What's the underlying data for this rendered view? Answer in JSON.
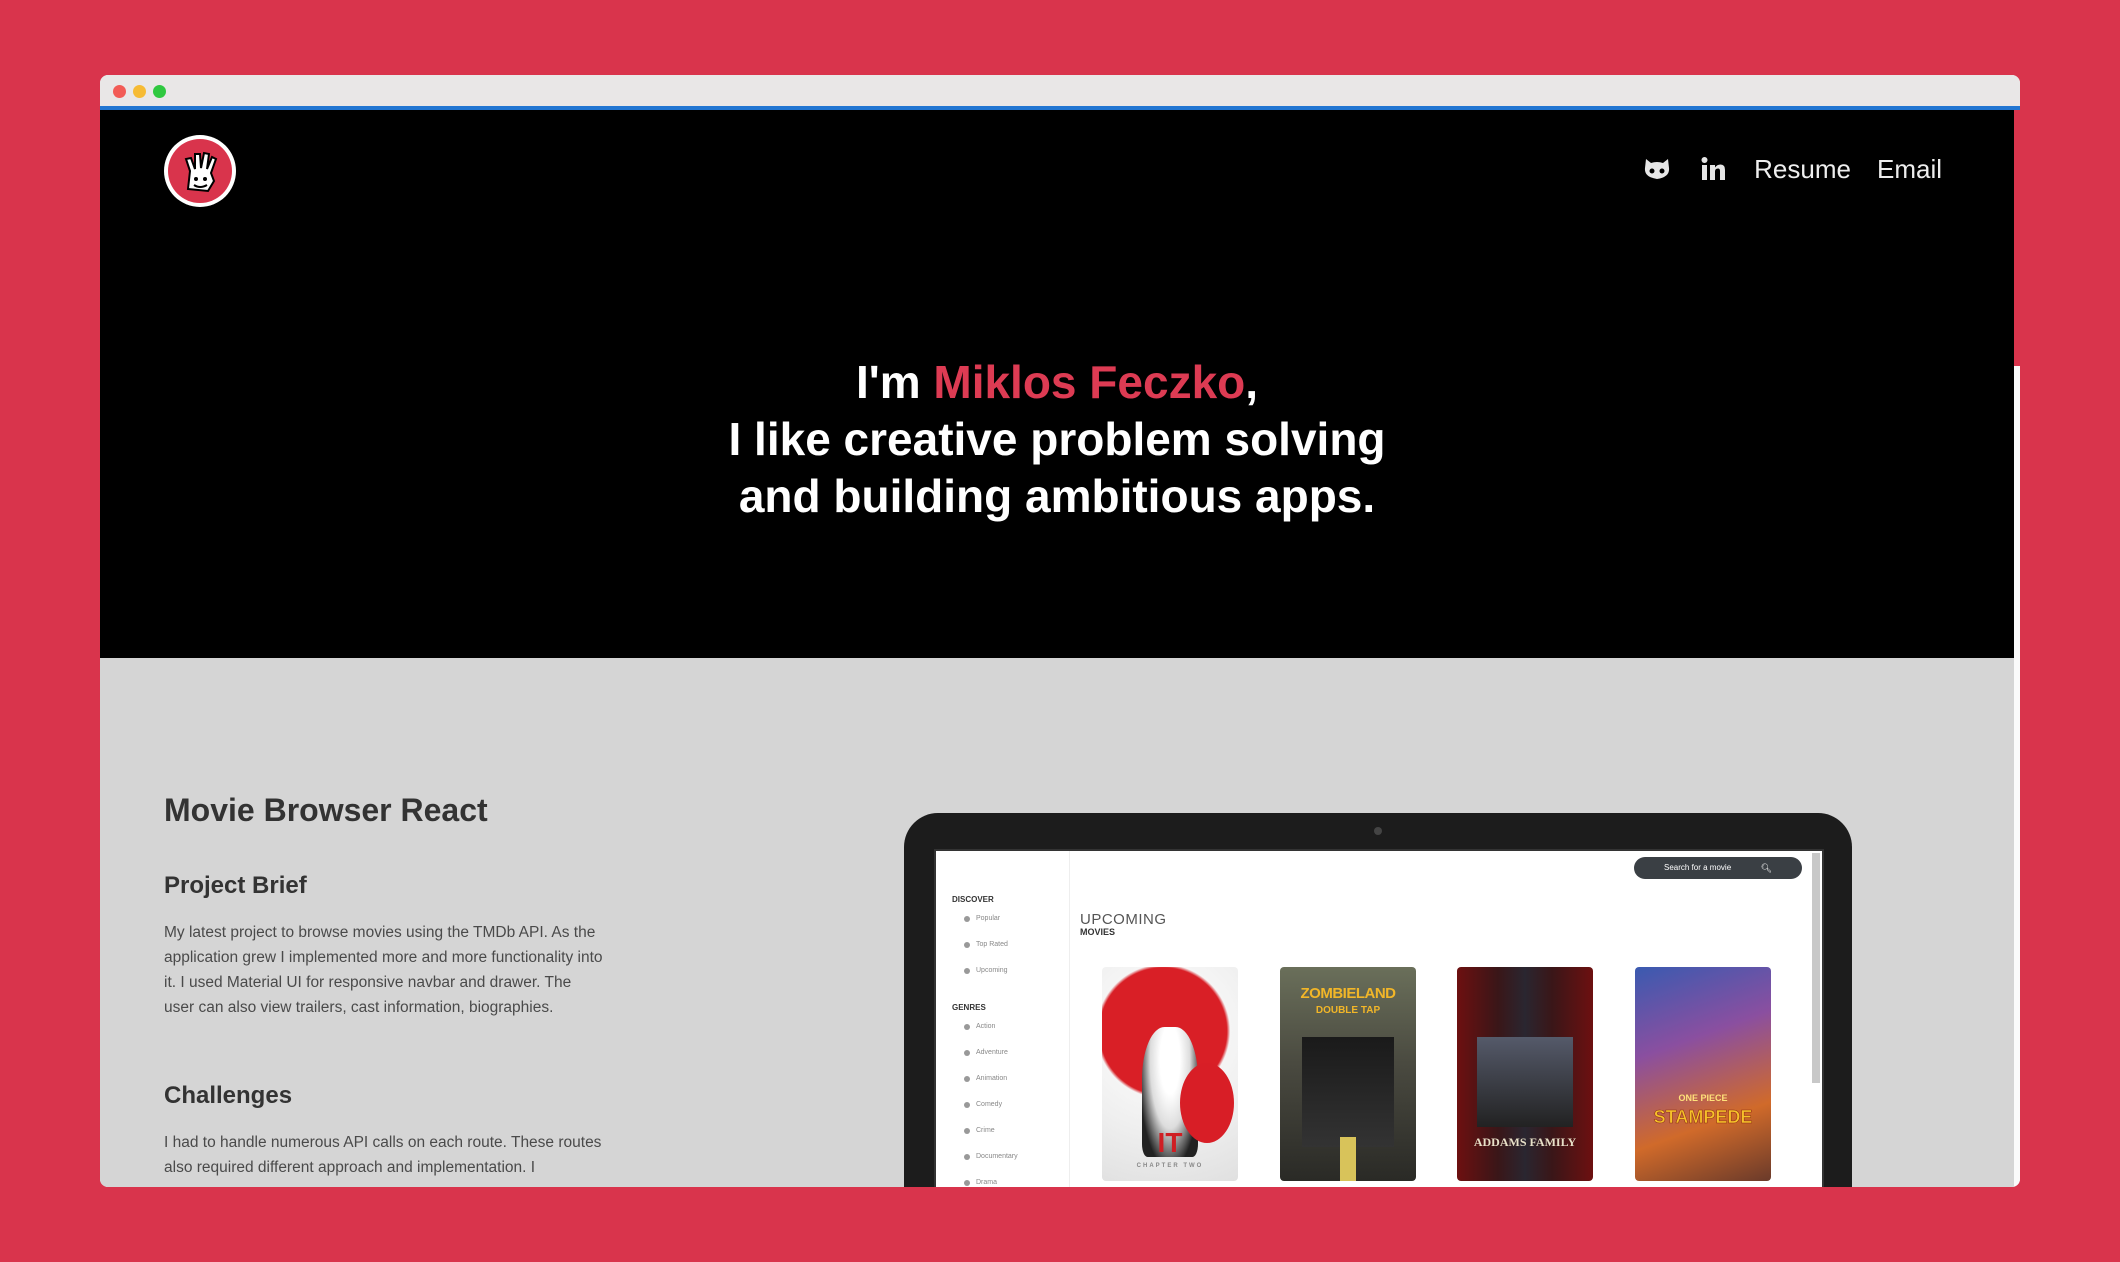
{
  "nav": {
    "github_icon": "github-icon",
    "linkedin_icon": "linkedin-icon",
    "resume": "Resume",
    "email": "Email"
  },
  "hero": {
    "prefix": "I'm ",
    "name": "Miklos Feczko",
    "comma": ",",
    "line2": "I like creative problem solving",
    "line3": "and building ambitious apps."
  },
  "project": {
    "title": "Movie Browser React",
    "brief_heading": "Project Brief",
    "brief_text": "My latest project to browse movies using the TMDb API. As the application grew I implemented more and more functionality into it. I used Material UI for responsive navbar and drawer. The user can also view trailers, cast information, biographies.",
    "challenges_heading": "Challenges",
    "challenges_text": "I had to handle numerous API calls on each route. These routes also required different approach and implementation. I"
  },
  "app_screenshot": {
    "search_placeholder": "Search for a movie",
    "discover_heading": "DISCOVER",
    "discover_items": [
      "Popular",
      "Top Rated",
      "Upcoming"
    ],
    "genres_heading": "GENRES",
    "genre_items": [
      "Action",
      "Adventure",
      "Animation",
      "Comedy",
      "Crime",
      "Documentary",
      "Drama"
    ],
    "section_title": "UPCOMING",
    "section_subtitle": "MOVIES",
    "posters": [
      {
        "title": "IT",
        "subtitle": "CHAPTER TWO"
      },
      {
        "title": "ZOMBIELAND",
        "subtitle": "DOUBLE TAP"
      },
      {
        "title": "ADDAMS FAMILY",
        "subtitle": ""
      },
      {
        "title": "STAMPEDE",
        "subtitle": "ONE PIECE"
      }
    ]
  },
  "colors": {
    "accent": "#d9344c",
    "hero_bg": "#000000",
    "section_bg": "#d5d5d5"
  }
}
